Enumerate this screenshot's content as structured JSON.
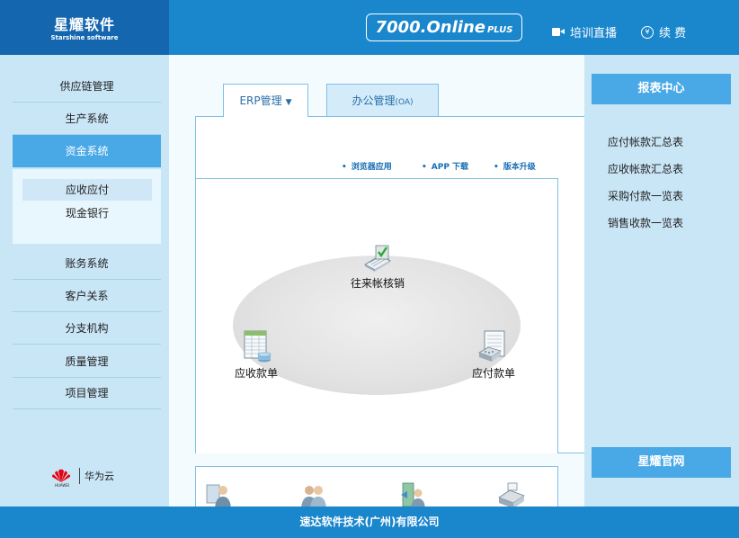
{
  "header": {
    "logo_title": "星耀软件",
    "logo_subtitle": "Starshine software",
    "product_name": "7000.Online",
    "product_edition": "PLUS",
    "live_label": "培训直播",
    "live_icon": "video-camera-icon",
    "renew_label": "续 费",
    "renew_icon": "yen-circle-icon"
  },
  "sidebar": {
    "items": [
      {
        "label": "供应链管理"
      },
      {
        "label": "生产系统"
      },
      {
        "label": "资金系统",
        "active": true
      },
      {
        "label": "账务系统"
      },
      {
        "label": "客户关系"
      },
      {
        "label": "分支机构"
      },
      {
        "label": "质量管理"
      },
      {
        "label": "项目管理"
      }
    ],
    "submenu": [
      {
        "label": "应收应付",
        "active": true
      },
      {
        "label": "现金银行"
      }
    ],
    "partner_brand_text": "HUAWEI",
    "partner_label": "华为云"
  },
  "tabs": [
    {
      "label": "ERP管理",
      "arrow": "▼"
    },
    {
      "label": "办公管理",
      "suffix": "(OA)"
    }
  ],
  "quick_links": [
    "浏览器应用",
    "APP 下载",
    "版本升级"
  ],
  "flow": {
    "center": "往来帐核销",
    "left": "应收款单",
    "right": "应付款单"
  },
  "right_panel": {
    "header": "报表中心",
    "items": [
      "应付帐款汇总表",
      "应收帐款汇总表",
      "采购付款一览表",
      "销售收款一览表"
    ],
    "official_site": "星耀官网"
  },
  "footer": {
    "company": "速达软件技术(广州)有限公司"
  },
  "colors": {
    "header_blue": "#1a86cc",
    "logo_blue": "#1466ae",
    "accent": "#49a8e6",
    "sidebar_bg": "#c9e6f7",
    "huawei_red": "#e60012"
  }
}
